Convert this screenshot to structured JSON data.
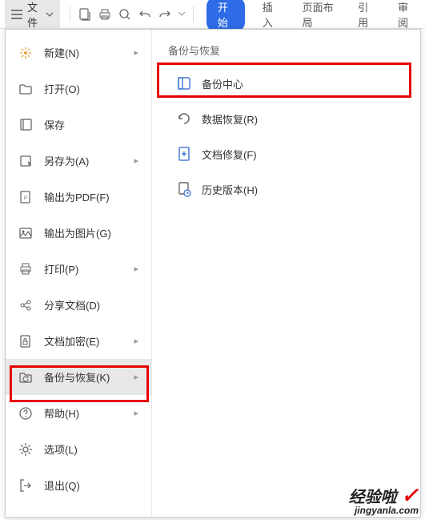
{
  "toolbar": {
    "file_label": "文件",
    "tabs": {
      "start": "开始",
      "insert": "插入",
      "layout": "页面布局",
      "reference": "引用",
      "review": "审阅"
    }
  },
  "menu": {
    "new": "新建(N)",
    "open": "打开(O)",
    "save": "保存",
    "saveas": "另存为(A)",
    "exportpdf": "输出为PDF(F)",
    "exportimg": "输出为图片(G)",
    "print": "打印(P)",
    "share": "分享文档(D)",
    "encrypt": "文档加密(E)",
    "backup": "备份与恢复(K)",
    "help": "帮助(H)",
    "options": "选项(L)",
    "exit": "退出(Q)"
  },
  "panel": {
    "title": "备份与恢复",
    "backup_center": "备份中心",
    "data_recover": "数据恢复(R)",
    "doc_repair": "文档修复(F)",
    "history": "历史版本(H)"
  },
  "watermark": {
    "line1": "经验啦",
    "line2": "jingyanla.com"
  }
}
